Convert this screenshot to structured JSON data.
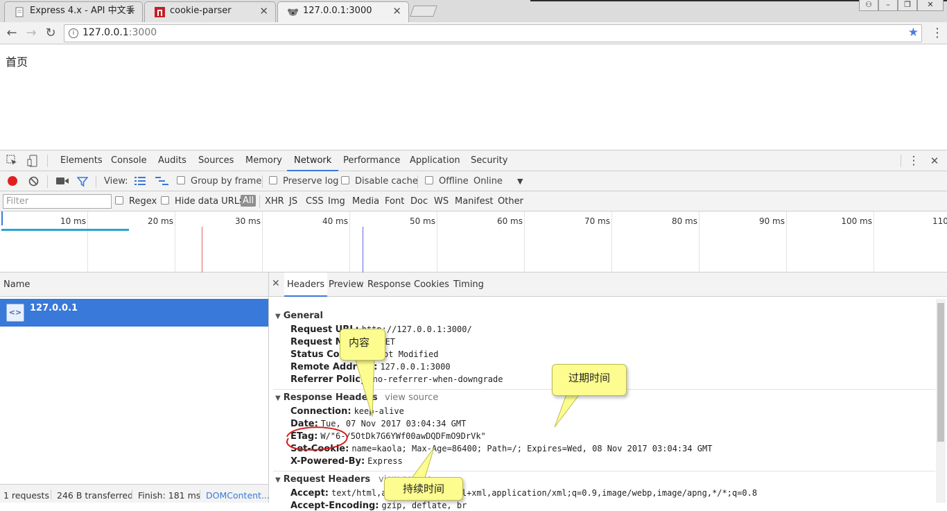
{
  "browser": {
    "tabs": [
      {
        "title": "Express 4.x - API 中文手"
      },
      {
        "title": "cookie-parser"
      },
      {
        "title": "127.0.0.1:3000"
      }
    ],
    "url_host": "127.0.0.1",
    "url_port": ":3000"
  },
  "page": {
    "heading": "首页"
  },
  "devtools": {
    "tabs": [
      "Elements",
      "Console",
      "Audits",
      "Sources",
      "Memory",
      "Network",
      "Performance",
      "Application",
      "Security"
    ],
    "active_tab": "Network",
    "toolbar": {
      "view_label": "View:",
      "group_by_frame": "Group by frame",
      "preserve_log": "Preserve log",
      "disable_cache": "Disable cache",
      "offline": "Offline",
      "throttle": "Online"
    },
    "filter": {
      "placeholder": "Filter",
      "regex": "Regex",
      "hide_data_urls": "Hide data URLs",
      "types": [
        "All",
        "XHR",
        "JS",
        "CSS",
        "Img",
        "Media",
        "Font",
        "Doc",
        "WS",
        "Manifest",
        "Other"
      ]
    },
    "timeline_ticks": [
      "10 ms",
      "20 ms",
      "30 ms",
      "40 ms",
      "50 ms",
      "60 ms",
      "70 ms",
      "80 ms",
      "90 ms",
      "100 ms",
      "110"
    ],
    "name_column": "Name",
    "request_name": "127.0.0.1",
    "summary": {
      "requests": "1 requests",
      "transferred": "246 B transferred",
      "finish": "Finish: 181 ms",
      "domcontent": "DOMContent..."
    },
    "detail_tabs": [
      "Headers",
      "Preview",
      "Response",
      "Cookies",
      "Timing"
    ],
    "general": {
      "title": "General",
      "request_url": {
        "k": "Request URL:",
        "v": "http://127.0.0.1:3000/"
      },
      "request_method": {
        "k": "Request Method:",
        "v": "GET"
      },
      "status_code": {
        "k": "Status Code:",
        "v": "304 Not Modified"
      },
      "remote_address": {
        "k": "Remote Address:",
        "v": "127.0.0.1:3000"
      },
      "referrer_policy": {
        "k": "Referrer Policy:",
        "v": "no-referrer-when-downgrade"
      }
    },
    "response_headers": {
      "title": "Response Headers",
      "view_source": "view source",
      "connection": {
        "k": "Connection:",
        "v": "keep-alive"
      },
      "date": {
        "k": "Date:",
        "v": "Tue, 07 Nov 2017 03:04:34 GMT"
      },
      "etag": {
        "k": "ETag:",
        "v": "W/\"6-/5OtDk7G6YWf00awDQDFmO9DrVk\""
      },
      "set_cookie": {
        "k": "Set-Cookie:",
        "v": "name=kaola; Max-Age=86400; Path=/; Expires=Wed, 08 Nov 2017 03:04:34 GMT"
      },
      "x_powered_by": {
        "k": "X-Powered-By:",
        "v": "Express"
      }
    },
    "request_headers": {
      "title": "Request Headers",
      "view_source": "view source",
      "accept": {
        "k": "Accept:",
        "v": "text/html,application/xhtml+xml,application/xml;q=0.9,image/webp,image/apng,*/*;q=0.8"
      },
      "accept_encoding": {
        "k": "Accept-Encoding:",
        "v": "gzip, deflate, br"
      }
    }
  },
  "annotations": {
    "content": "内容",
    "expiry": "过期时间",
    "duration": "持续时间"
  },
  "colors": {
    "accent_blue": "#3879d9",
    "record_red": "#e0201f",
    "callout_yellow": "#fdfd8f",
    "circle_red": "#d41f1f"
  }
}
